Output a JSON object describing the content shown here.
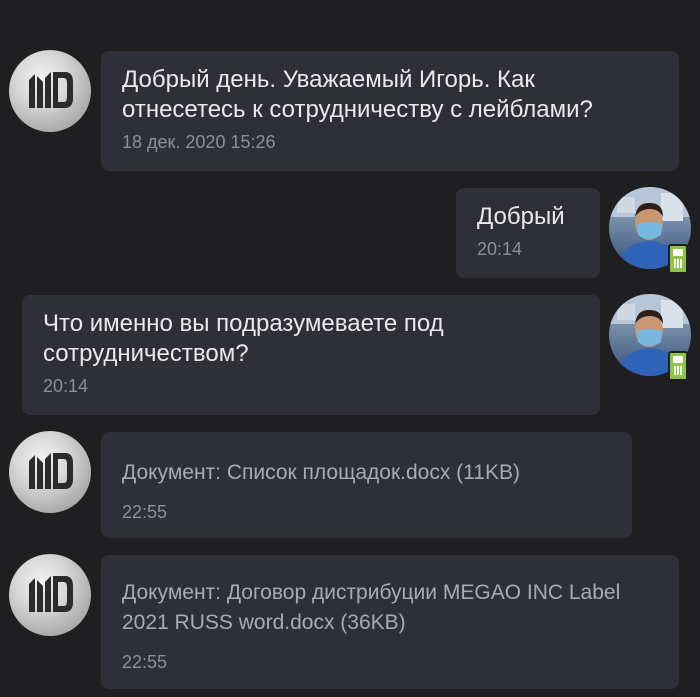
{
  "messages": [
    {
      "sender": "label",
      "text": "Добрый день. Уважаемый Игорь. Как отнесетесь к сотрудничеству с лейблами?",
      "time": "18 дек. 2020 15:26",
      "avatar": "md-logo-icon"
    },
    {
      "sender": "self",
      "text": "Добрый",
      "time": "20:14",
      "avatar": "user-photo"
    },
    {
      "sender": "self",
      "text": "Что именно вы подразумеваете под сотрудничеством?",
      "time": "20:14",
      "avatar": "user-photo"
    },
    {
      "sender": "label",
      "text": "Документ: Список площадок.docx (11KB)",
      "time": "22:55",
      "avatar": "md-logo-icon"
    },
    {
      "sender": "label",
      "text": "Документ: Договор дистрибуции MEGAO INC Label 2021 RUSS word.docx (36KB)",
      "time": "22:55",
      "avatar": "md-logo-icon"
    }
  ],
  "colors": {
    "background": "#1f1f21",
    "bubble": "#2f3037",
    "text": "#e9e9ec",
    "document_text": "#a9abb4",
    "time": "#8d8f99",
    "mobile_badge": "#8fc34a"
  }
}
